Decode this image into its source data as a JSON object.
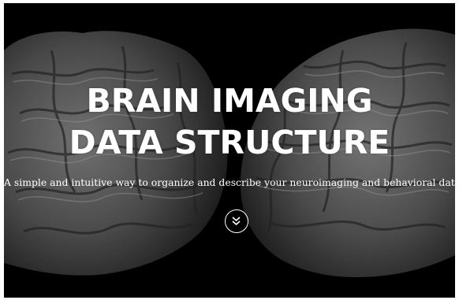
{
  "hero": {
    "title_line1": "BRAIN IMAGING",
    "title_line2": "DATA STRUCTURE",
    "tagline": "A simple and intuitive way to organize and describe your neuroimaging and behavioral data.",
    "scroll_icon": "double-chevron-down-icon",
    "background_image": "brain-hemispheres-grayscale"
  },
  "colors": {
    "background": "#000000",
    "text": "#ffffff"
  }
}
